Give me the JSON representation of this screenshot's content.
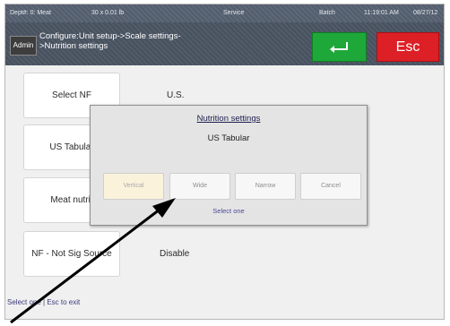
{
  "status": {
    "dept": "Dept#: 0: Meat",
    "weight": "30 x 0.01 lb",
    "mode": "Service",
    "batch": "Batch",
    "time": "11:19:01 AM",
    "date": "08/27/12"
  },
  "header": {
    "badge": "Admin",
    "crumb_line1": "Configure:Unit setup->Scale settings-",
    "crumb_line2": ">Nutrition settings",
    "enter_icon": "enter-return-icon",
    "esc_label": "Esc"
  },
  "settings": [
    {
      "label": "Select NF",
      "value": "U.S."
    },
    {
      "label": "US Tabular",
      "value": ""
    },
    {
      "label": "Meat nutrif",
      "value": ""
    },
    {
      "label": "NF - Not Sig Source",
      "value": "Disable"
    }
  ],
  "footer": {
    "hint": "Select one | Esc to exit"
  },
  "dialog": {
    "title": "Nutrition settings",
    "subtitle": "US Tabular",
    "options": [
      {
        "label": "Vertical",
        "selected": true
      },
      {
        "label": "Wide",
        "selected": false
      },
      {
        "label": "Narrow",
        "selected": false
      },
      {
        "label": "Cancel",
        "selected": false
      }
    ],
    "hint": "Select one"
  },
  "colors": {
    "enter": "#1fa83a",
    "esc": "#dd1f26",
    "header": "#4d5664"
  }
}
